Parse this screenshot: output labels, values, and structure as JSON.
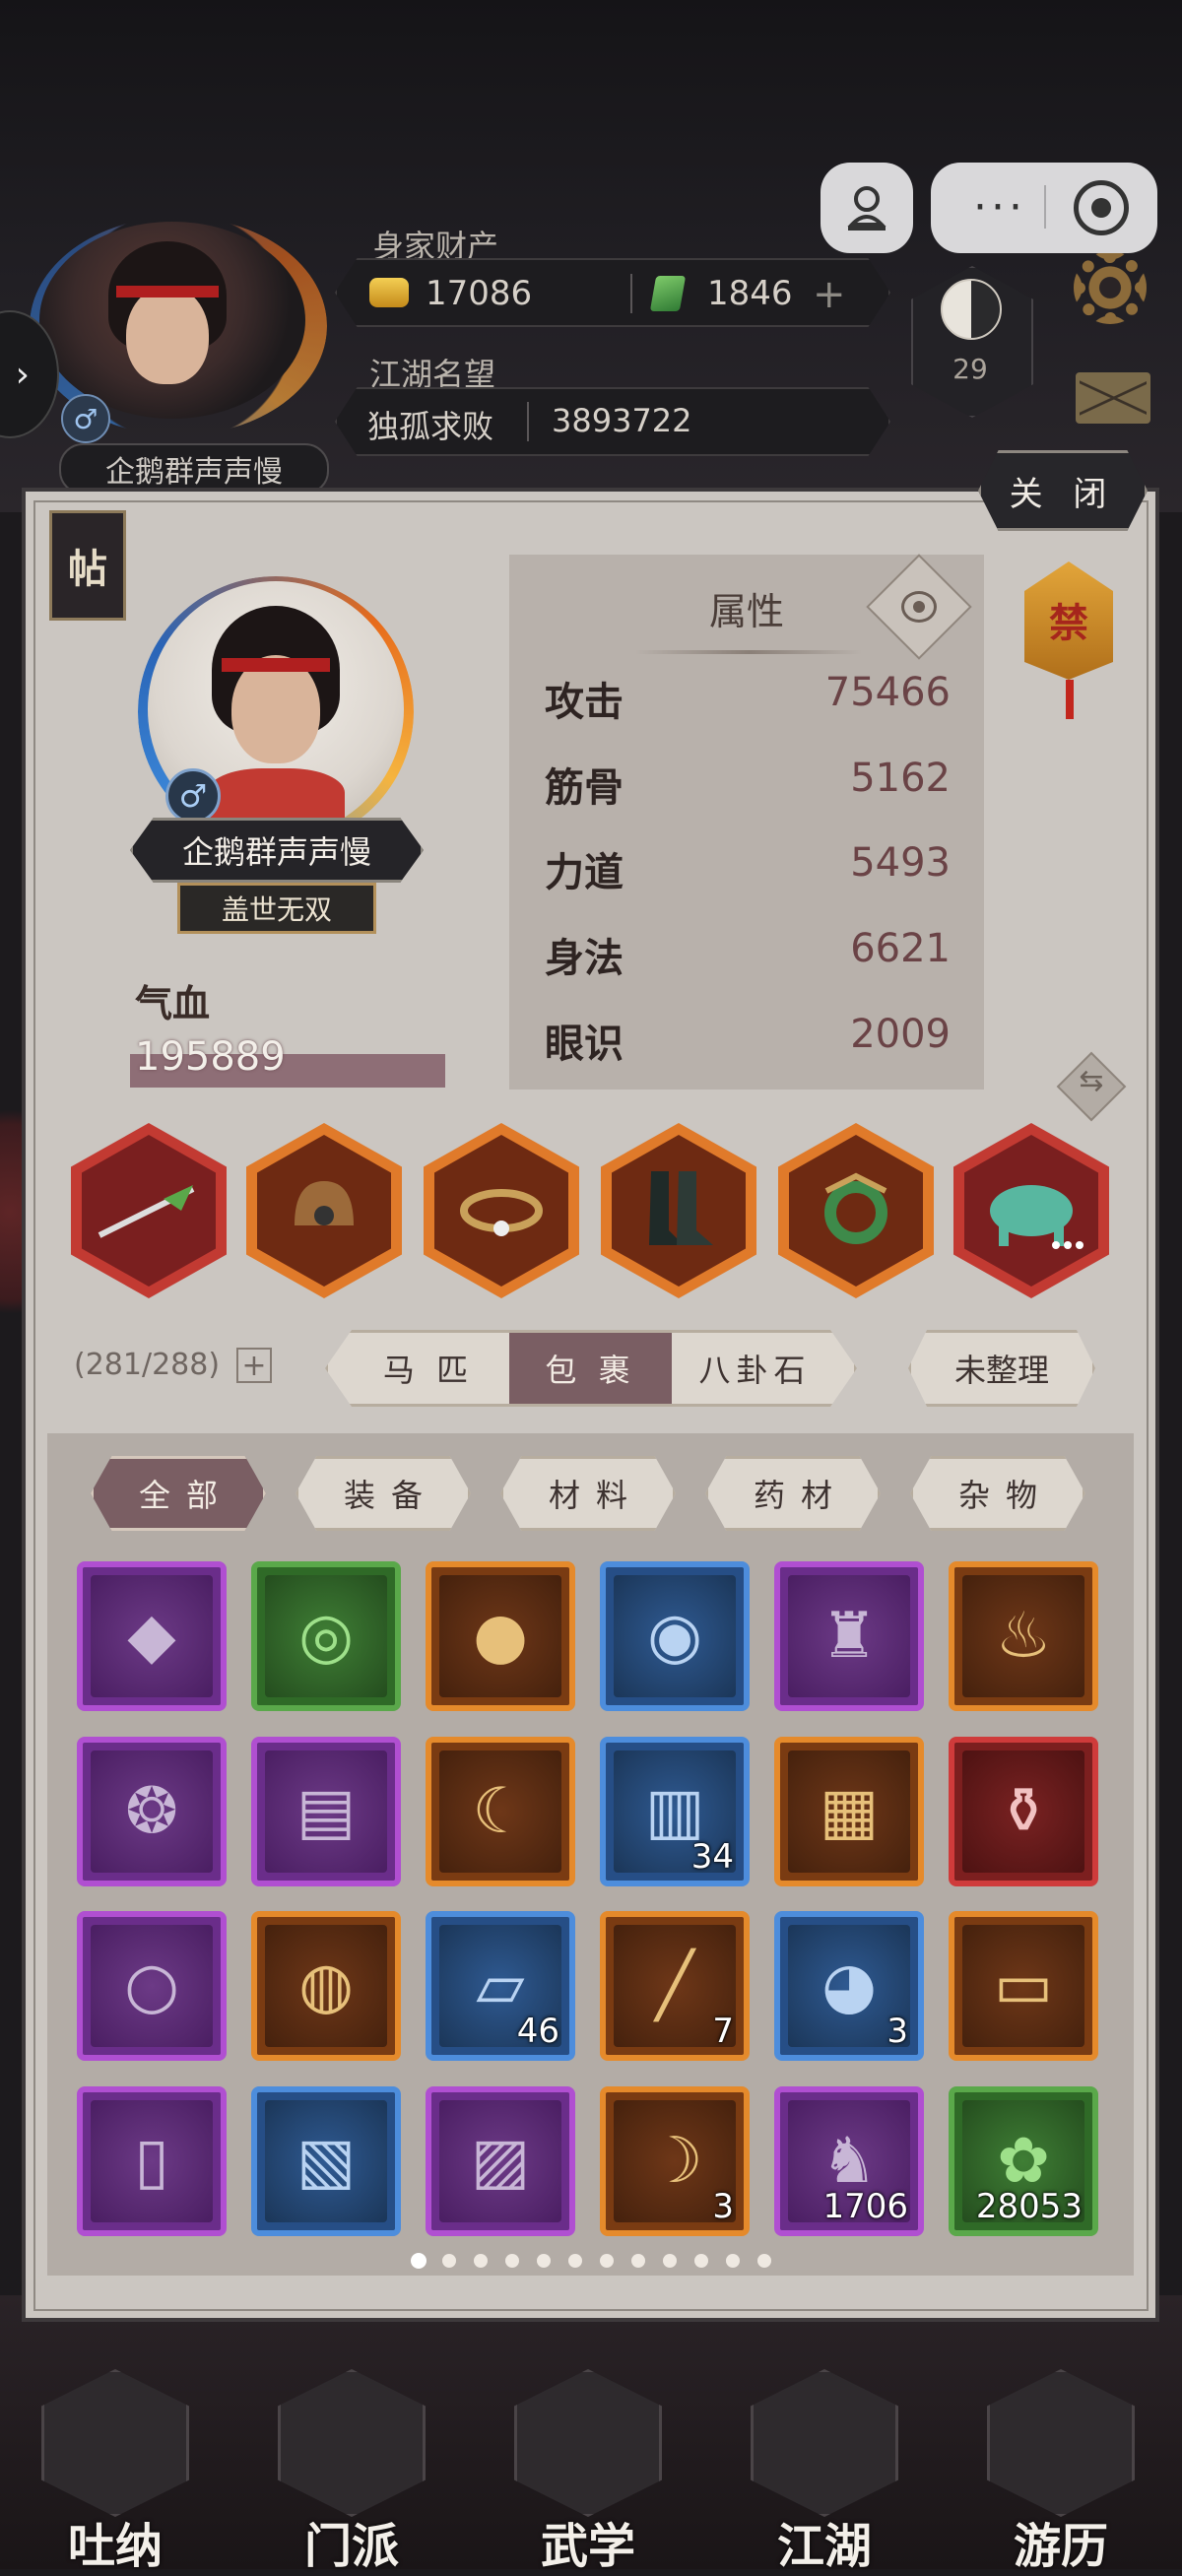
{
  "hud": {
    "wealth_label": "身家财产",
    "gold_value": "17086",
    "jade_value": "1846",
    "add_symbol": "+",
    "fame_label": "江湖名望",
    "fame_title": "独孤求败",
    "fame_value": "3893722",
    "player_name": "企鹅群声声慢",
    "taiji_level": "29",
    "gender_symbol": "♂",
    "expand_arrow": "›"
  },
  "miniprogram": {
    "more_symbol": "···"
  },
  "panel": {
    "close_label": "关 闭",
    "tie_label": "帖",
    "seal_text": "禁",
    "swap_symbol": "⇆"
  },
  "character": {
    "name": "企鹅群声声慢",
    "title": "盖世无双",
    "gender_symbol": "♂",
    "hp_label": "气血",
    "hp_value": "195889"
  },
  "attributes": {
    "title": "属性",
    "items": [
      {
        "name": "攻击",
        "value": "75466"
      },
      {
        "name": "筋骨",
        "value": "5162"
      },
      {
        "name": "力道",
        "value": "5493"
      },
      {
        "name": "身法",
        "value": "6621"
      },
      {
        "name": "眼识",
        "value": "2009"
      }
    ]
  },
  "equipment": [
    {
      "icon": "spear-icon",
      "quality_color": "#c23a32"
    },
    {
      "icon": "helmet-icon",
      "quality_color": "#e07a2a"
    },
    {
      "icon": "ring-icon",
      "quality_color": "#e07a2a"
    },
    {
      "icon": "boots-icon",
      "quality_color": "#e07a2a"
    },
    {
      "icon": "amulet-icon",
      "quality_color": "#e07a2a"
    },
    {
      "icon": "mount-icon",
      "quality_color": "#c23a32"
    }
  ],
  "bag": {
    "capacity": "(281/288)",
    "add_symbol": "+",
    "tabs": [
      "马 匹",
      "包 裹",
      "八卦石"
    ],
    "active_tab": 1,
    "sort_label": "未整理",
    "filters": [
      "全部",
      "装备",
      "材料",
      "药材",
      "杂物"
    ],
    "active_filter": 0
  },
  "items": [
    {
      "icon": "jade-stone-icon",
      "quality": "purple",
      "count": ""
    },
    {
      "icon": "jade-pendant-icon",
      "quality": "green",
      "count": ""
    },
    {
      "icon": "gem-icon",
      "quality": "orange",
      "count": ""
    },
    {
      "icon": "silver-orb-icon",
      "quality": "blue",
      "count": ""
    },
    {
      "icon": "censer-icon",
      "quality": "purple",
      "count": ""
    },
    {
      "icon": "incense-bowl-icon",
      "quality": "orange",
      "count": ""
    },
    {
      "icon": "jade-token-icon",
      "quality": "purple",
      "count": ""
    },
    {
      "icon": "scripture-book-icon",
      "quality": "purple",
      "count": ""
    },
    {
      "icon": "moon-pendant-icon",
      "quality": "orange",
      "count": ""
    },
    {
      "icon": "manual-books-icon",
      "quality": "blue",
      "count": "34"
    },
    {
      "icon": "secret-book-icon",
      "quality": "orange",
      "count": ""
    },
    {
      "icon": "vase-icon",
      "quality": "red",
      "count": ""
    },
    {
      "icon": "pearl-icon",
      "quality": "purple",
      "count": ""
    },
    {
      "icon": "bi-disc-icon",
      "quality": "orange",
      "count": ""
    },
    {
      "icon": "map-fragment-icon",
      "quality": "blue",
      "count": "46"
    },
    {
      "icon": "bamboo-stick-icon",
      "quality": "orange",
      "count": "7"
    },
    {
      "icon": "crystal-ball-icon",
      "quality": "blue",
      "count": "3"
    },
    {
      "icon": "scroll-icon",
      "quality": "orange",
      "count": ""
    },
    {
      "icon": "painting-scroll-icon",
      "quality": "purple",
      "count": ""
    },
    {
      "icon": "blue-book-icon",
      "quality": "blue",
      "count": ""
    },
    {
      "icon": "green-book-icon",
      "quality": "purple",
      "count": ""
    },
    {
      "icon": "fang-icon",
      "quality": "orange",
      "count": "3"
    },
    {
      "icon": "beast-token-icon",
      "quality": "purple",
      "count": "1706"
    },
    {
      "icon": "flower-icon",
      "quality": "green",
      "count": "28053"
    }
  ],
  "pagination": {
    "pages": 12,
    "active": 0
  },
  "nav": [
    {
      "label": "吐纳",
      "icon": "meditation-icon"
    },
    {
      "label": "门派",
      "icon": "sect-icon"
    },
    {
      "label": "武学",
      "icon": "martial-arts-icon"
    },
    {
      "label": "江湖",
      "icon": "jianghu-icon"
    },
    {
      "label": "游历",
      "icon": "travel-icon"
    }
  ]
}
